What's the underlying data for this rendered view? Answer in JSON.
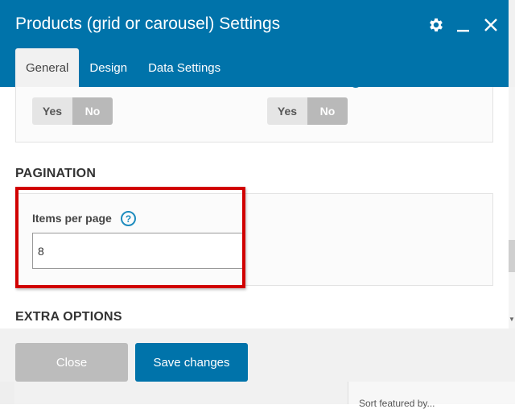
{
  "modal": {
    "title": "Products (grid or carousel) Settings",
    "header_icons": [
      "gear-icon",
      "minimize-icon",
      "close-icon"
    ],
    "tabs": [
      {
        "label": "General",
        "active": true
      },
      {
        "label": "Design",
        "active": false
      },
      {
        "label": "Data Settings",
        "active": false
      }
    ]
  },
  "toggles": [
    {
      "yes": "Yes",
      "no": "No",
      "selected": "No"
    },
    {
      "yes": "Yes",
      "no": "No",
      "selected": "No"
    }
  ],
  "pagination": {
    "section_title": "PAGINATION",
    "items_label": "Items per page",
    "help_glyph": "?",
    "items_value": "8"
  },
  "extra": {
    "section_title": "EXTRA OPTIONS"
  },
  "footer": {
    "close_label": "Close",
    "save_label": "Save changes"
  },
  "background": {
    "partial_text": "Sort featured by..."
  },
  "colors": {
    "header_bg": "#0073aa",
    "save_button": "#0073aa",
    "close_button": "#bcbcbc",
    "highlight": "#d10000"
  }
}
